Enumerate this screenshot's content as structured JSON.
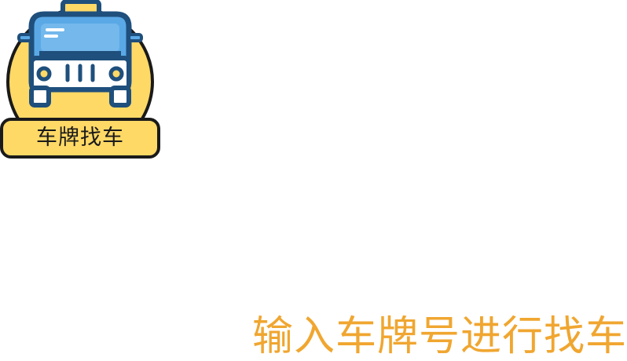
{
  "app_icon": {
    "name": "taxi-icon",
    "label": "车牌找车",
    "colors": {
      "badge": "#ffd966",
      "outline": "#1f4f7c",
      "car_body": "#5aa9e6",
      "caption_bg": "#ffd966",
      "caption_text": "#1a1a1a"
    }
  },
  "prompt": {
    "text": "输入车牌号进行找车",
    "color": "#f0a630"
  }
}
